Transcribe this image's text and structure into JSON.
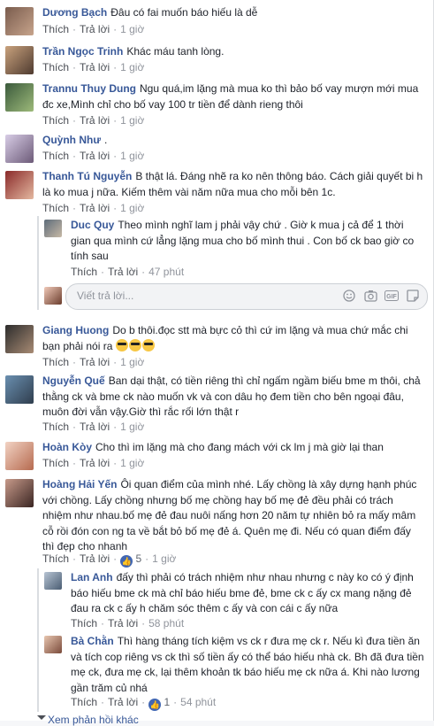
{
  "actions": {
    "like": "Thích",
    "reply": "Trả lời",
    "sep": "·"
  },
  "comments": [
    {
      "name": "Dương Bạch",
      "text": "Đâu có fai muốn báo hiếu là dễ",
      "time": "1 giờ"
    },
    {
      "name": "Trần Ngọc Trinh",
      "text": "Khác máu tanh lòng.",
      "time": "1 giờ"
    },
    {
      "name": "Trannu Thuy Dung",
      "text": "Ngu quá,im lặng mà mua ko thì bảo bố vay mượn mới mua đc xe,Mình chỉ cho bố vay 100 tr tiền để dành rieng thôi",
      "time": "1 giờ"
    },
    {
      "name": "Quỳnh Như",
      "text": ".",
      "time": "1 giờ"
    },
    {
      "name": "Thanh Tú Nguyễn",
      "text": "B thật lá. Đáng nhẽ ra ko nên thông báo. Cách giải quyết bi h là ko mua j nữa. Kiếm thêm vài năm nữa mua cho mỗi bên 1c.",
      "time": "1 giờ"
    },
    {
      "name": "Giang Huong",
      "text": "Do b thôi.đọc stt mà bực cỏ thì cứ im lặng và mua chứ mắc chi bạn phải nói ra",
      "time": "1 giờ"
    },
    {
      "name": "Nguyễn Quế",
      "text": "Ban dại thật, có tiền riêng thì chỉ ngấm ngầm biếu bme m thôi, chả thằng ck và bme ck nào muốn vk và con dâu họ đem tiền cho bên ngoại đâu, muôn đời vẫn vậy.Giờ thì rắc rối lớn thật r",
      "time": "1 giờ"
    },
    {
      "name": "Hoàn Kòy",
      "text": "Cho thì im lặng mà cho đang mách với ck lm j mà giờ lại than",
      "time": "1 giờ"
    },
    {
      "name": "Hoàng Hải Yến",
      "text": "Ôi quan điểm của mình nhé. Lấy chồng là xây dựng hạnh phúc với chồng. Lấy chồng nhưng bố mẹ chồng hay bố mẹ đẻ đều phải có trách nhiệm như nhau.bố mẹ đẻ đau nuôi nấng hơn 20 năm tự nhiên bỏ ra mấy mâm cỗ rồi đón con ng ta về bắt bỏ bố mẹ đẻ á. Quên mẹ đi. Nếu có quan điểm đấy thì đẹp cho nhanh",
      "likes": "5",
      "time": "1 giờ"
    }
  ],
  "replies": {
    "thanh_tu": {
      "name": "Duc Quy",
      "text": "Theo mình nghĩ lam j phải vậy chứ . Giờ k mua j cả để 1 thời gian qua mình cứ lẳng lặng mua cho bố mình thui . Con bố ck bao giờ co tính sau",
      "time": "47 phút"
    },
    "hoang_hai_yen": [
      {
        "name": "Lan Anh",
        "text": "đấy thì phải có trách nhiệm như nhau nhưng c này ko có ý định báo hiếu bme ck mà chỉ báo hiếu bme đẻ, bme ck c ấy cx mang nặng đẻ đau ra ck c ấy h chăm sóc thêm c ấy và con cái c ấy nữa",
        "time": "58 phút"
      },
      {
        "name": "Bà Chằn",
        "text": "Thì hàng tháng tích kiệm vs ck r đưa mẹ ck r. Nếu kì đưa tiền ăn và tích cop riêng vs ck thì số tiền ấy có thể báo hiếu nhà ck. Bh đã đưa tiền mẹ ck, đưa mẹ ck, lại thêm khoản tk báo hiếu mẹ ck nữa á. Khi nào lương gần trăm củ nhá",
        "likes": "1",
        "time": "54 phút"
      }
    ]
  },
  "write_reply_placeholder": "Viết trả lời...",
  "more_replies": "Xem phản hồi khác",
  "emoji_count": "3"
}
